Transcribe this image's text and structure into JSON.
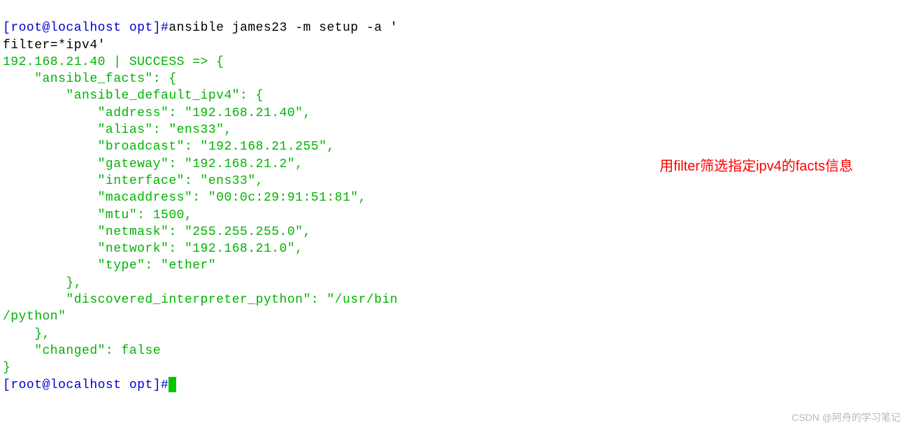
{
  "prompt1": {
    "open": "[",
    "userhost": "root@localhost opt",
    "close": "]#",
    "cmd": "ansible james23 -m setup -a '"
  },
  "line2": "filter=*ipv4'",
  "out_line1": "192.168.21.40 | SUCCESS => {",
  "out_line2": "    \"ansible_facts\": {",
  "out_line3": "        \"ansible_default_ipv4\": {",
  "out_line4": "            \"address\": \"192.168.21.40\",",
  "out_line5": "            \"alias\": \"ens33\",",
  "out_line6": "            \"broadcast\": \"192.168.21.255\",",
  "out_line7": "            \"gateway\": \"192.168.21.2\",",
  "out_line8": "            \"interface\": \"ens33\",",
  "out_line9": "            \"macaddress\": \"00:0c:29:91:51:81\",",
  "out_line10": "            \"mtu\": 1500,",
  "out_line11": "            \"netmask\": \"255.255.255.0\",",
  "out_line12": "            \"network\": \"192.168.21.0\",",
  "out_line13": "            \"type\": \"ether\"",
  "out_line14": "        },",
  "out_line15": "        \"discovered_interpreter_python\": \"/usr/bin",
  "out_line16": "/python\"",
  "out_line17": "    },",
  "out_line18": "    \"changed\": false",
  "out_line19": "}",
  "prompt2": {
    "open": "[",
    "userhost": "root@localhost opt",
    "close": "]#"
  },
  "annotation": "用filter筛选指定ipv4的facts信息",
  "watermark": "CSDN @阿舟的学习笔记"
}
